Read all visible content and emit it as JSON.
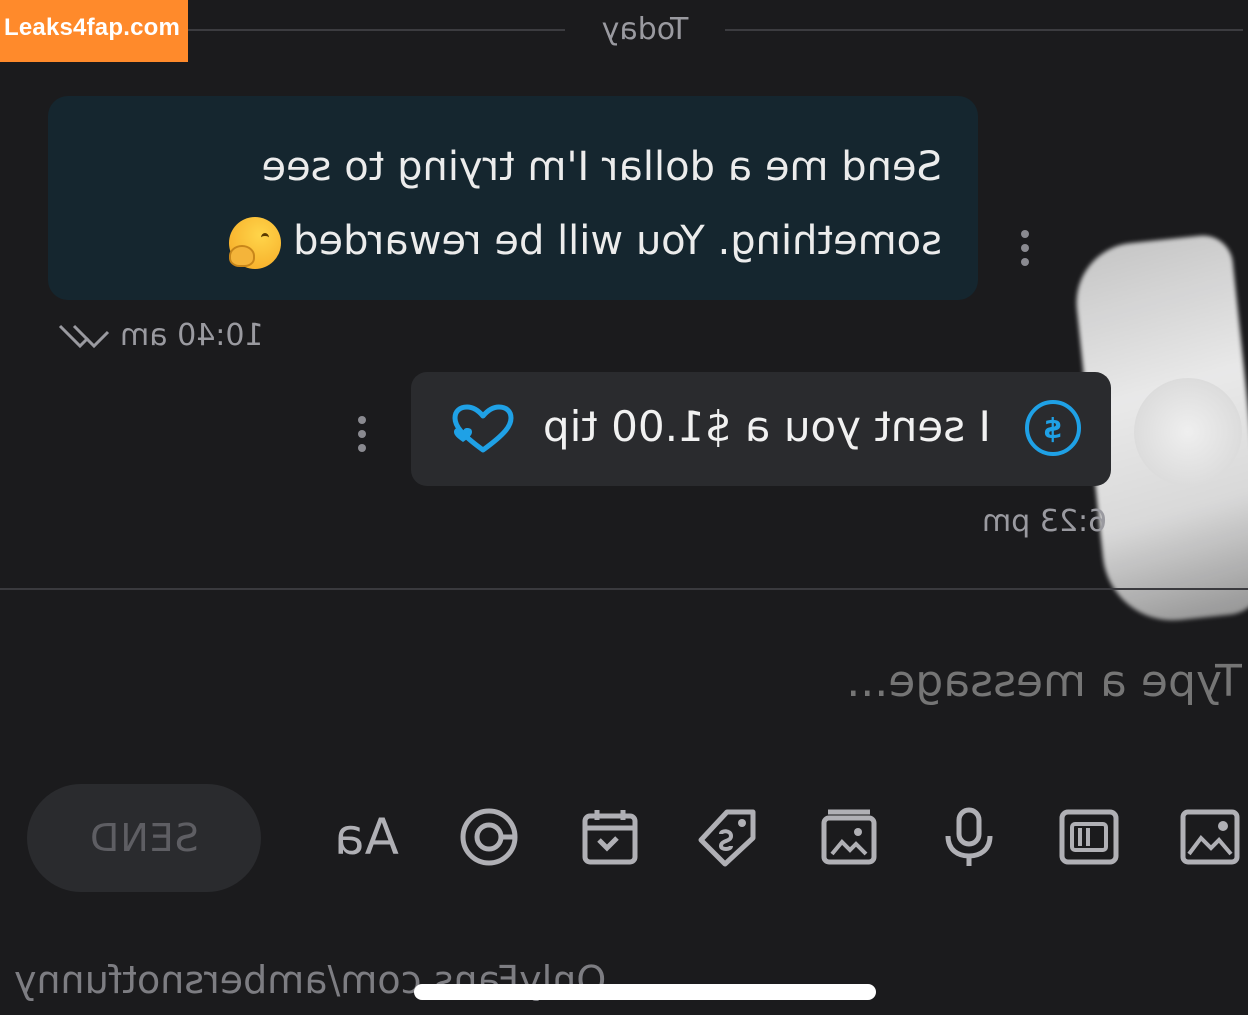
{
  "watermark": {
    "text": "Leaks4fap.com"
  },
  "day_divider": {
    "label": "Today"
  },
  "incoming_message": {
    "lines": [
      "Send me a dollar I'm trying to see",
      "something. You will be rewarded"
    ],
    "emoji": "hand-over-mouth-face",
    "timestamp": "10:40 am",
    "read_status": "double-check-icon"
  },
  "outgoing_message": {
    "tip_text": "I sent you a $1.00 tip",
    "tip_icon_glyph": "$",
    "timestamp": "6:23 pm",
    "accent": "#1fa1e6"
  },
  "composer": {
    "placeholder": "Type a message...",
    "send_label": "SEND",
    "text_format_label": "Aa"
  },
  "toolbar_icons": [
    "image-icon",
    "gif-icon",
    "microphone-icon",
    "vault-icon",
    "price-tag-icon",
    "schedule-icon",
    "quiz-icon",
    "text-format-icon"
  ],
  "footer": {
    "url": "OnlyFans.com/ambersnotfunny"
  },
  "colors": {
    "background": "#1b1b1d",
    "incoming_bubble": "#15262f",
    "outgoing_bubble": "#2a2b2e",
    "watermark": "#ff8a2b"
  }
}
